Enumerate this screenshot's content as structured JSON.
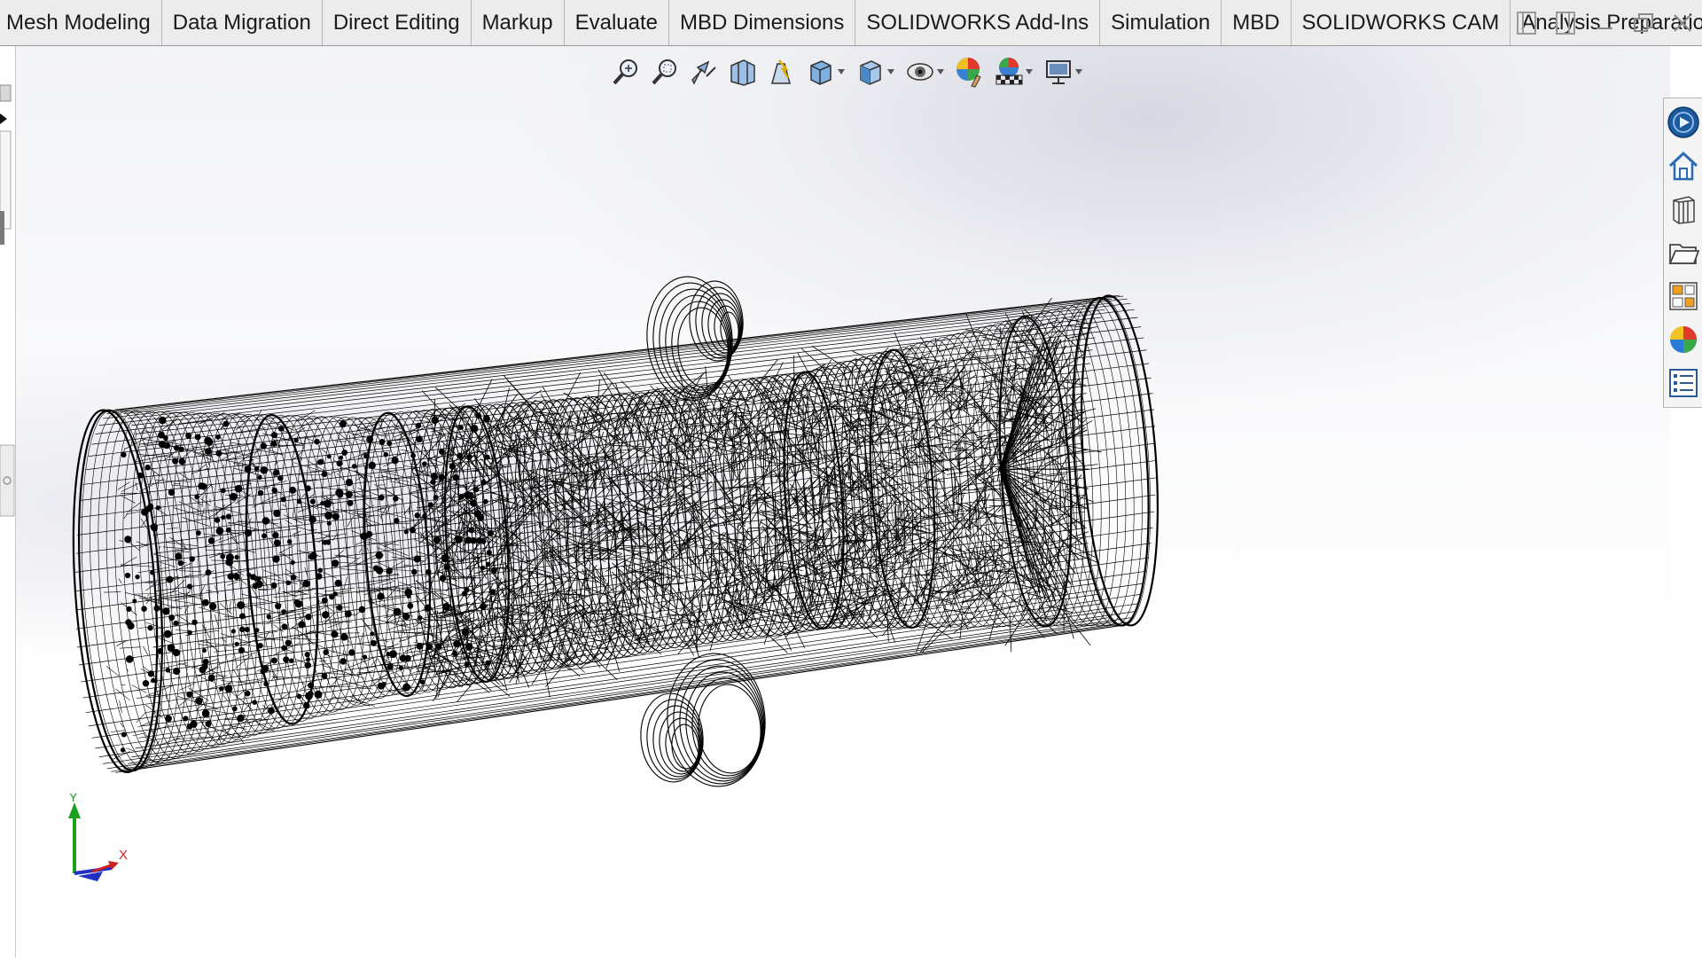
{
  "tabs": [
    {
      "label": "Mesh Modeling"
    },
    {
      "label": "Data Migration"
    },
    {
      "label": "Direct Editing"
    },
    {
      "label": "Markup"
    },
    {
      "label": "Evaluate"
    },
    {
      "label": "MBD Dimensions"
    },
    {
      "label": "SOLIDWORKS Add-Ins"
    },
    {
      "label": "Simulation"
    },
    {
      "label": "MBD"
    },
    {
      "label": "SOLIDWORKS CAM"
    },
    {
      "label": "Analysis Preparation"
    }
  ],
  "window_controls": [
    "panel-left-icon",
    "panel-right-icon",
    "minimize-icon",
    "restore-icon",
    "close-icon"
  ],
  "heads_up_toolbar": [
    "zoom-to-fit-icon",
    "zoom-to-area-icon",
    "previous-view-icon",
    "section-view-icon",
    "dynamic-annotation-views-icon",
    "view-orientation-icon",
    "display-style-icon",
    "hide-show-items-icon",
    "edit-appearance-icon",
    "apply-scene-icon",
    "view-settings-icon"
  ],
  "task_pane": [
    "solidworks-resources-icon",
    "home-icon",
    "design-library-icon",
    "file-explorer-icon",
    "view-palette-icon",
    "appearances-icon",
    "custom-properties-icon"
  ],
  "triad": {
    "y_label": "Y",
    "x_label": "X"
  },
  "colors": {
    "tab_bg": "#ececec",
    "wireframe": "#000000",
    "axis_y": "#1aa01a",
    "axis_x": "#d02020",
    "axis_z": "#2030c0"
  }
}
